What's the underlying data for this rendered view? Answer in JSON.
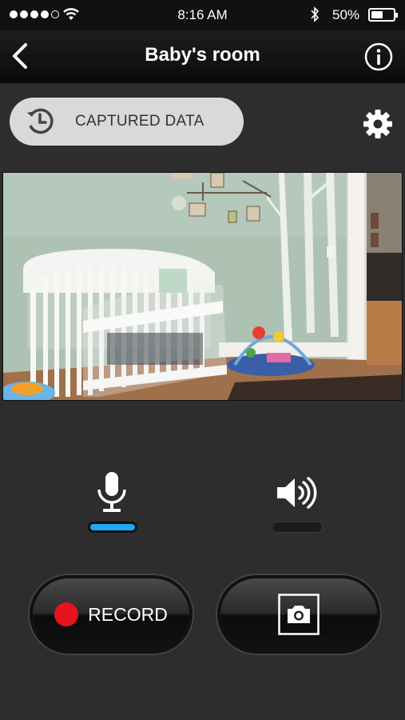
{
  "status_bar": {
    "time": "8:16 AM",
    "battery": "50%",
    "signal_dots_filled": 4,
    "icons": [
      "signal-icon",
      "wifi-icon",
      "bluetooth-icon",
      "battery-icon"
    ]
  },
  "nav": {
    "title": "Baby's room",
    "back_icon": "chevron-left-icon",
    "info_icon": "info-icon"
  },
  "captured": {
    "label": "CAPTURED DATA",
    "icon": "history-clock-icon",
    "button_color": "#d9d9d9"
  },
  "settings_icon": "gear-icon",
  "camera_feed": {
    "description_icon": "nursery-camera-view"
  },
  "audio": {
    "mic_icon": "microphone-icon",
    "mic_active": true,
    "speaker_icon": "speaker-icon",
    "speaker_active": false,
    "active_color": "#1ea7f5"
  },
  "record": {
    "label": "RECORD",
    "dot_color": "#e6141b"
  },
  "snapshot_icon": "camera-icon"
}
